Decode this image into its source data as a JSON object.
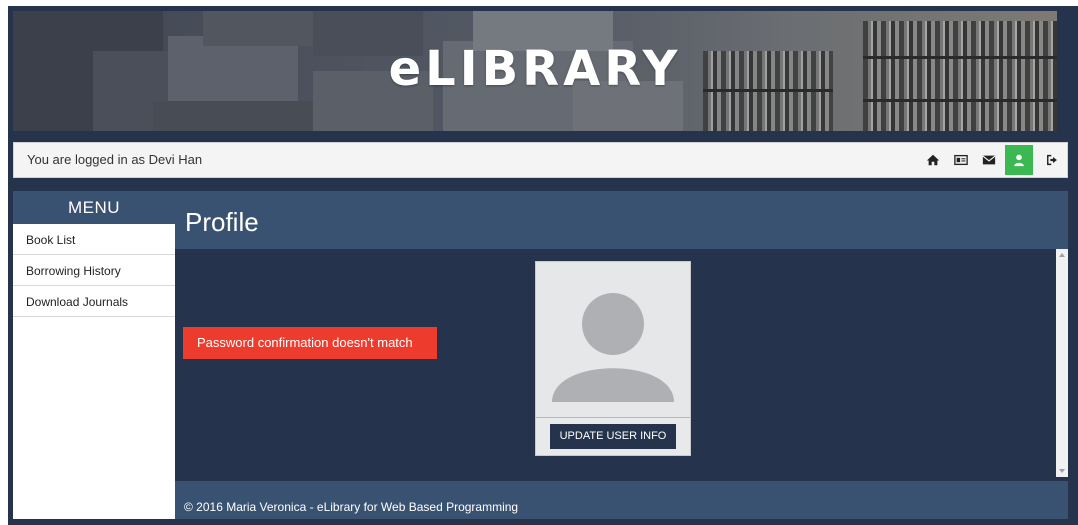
{
  "banner": {
    "title": "eLIBRARY"
  },
  "status": {
    "logged_in_text": "You are logged in as Devi Han",
    "icons": [
      "home-icon",
      "id-card-icon",
      "envelope-icon",
      "user-icon",
      "sign-out-icon"
    ]
  },
  "menu": {
    "header": "MENU",
    "items": [
      {
        "label": "Book List"
      },
      {
        "label": "Borrowing History"
      },
      {
        "label": "Download Journals"
      }
    ]
  },
  "main": {
    "title": "Profile",
    "alert": "Password confirmation doesn't match",
    "update_button": "UPDATE USER INFO"
  },
  "footer": {
    "text": "© 2016 Maria Veronica - eLibrary for Web Based Programming"
  },
  "colors": {
    "navy": "#25344c",
    "header_blue": "#3a5272",
    "alert_red": "#ed3b2e",
    "active_green": "#3cb852"
  }
}
